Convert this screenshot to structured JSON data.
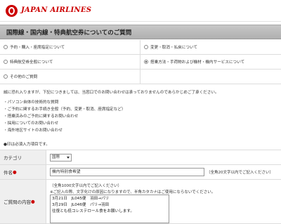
{
  "brand": {
    "name": "JAPAN AIRLINES",
    "color": "#cc0000"
  },
  "page_title": "国際線・国内線・特典航空券についてのご質問",
  "topics": [
    {
      "label": "予約・購入・座席指定について",
      "checked": false
    },
    {
      "label": "変更・取消・払戻について",
      "checked": false
    },
    {
      "label": "特典航空券全般について",
      "checked": false
    },
    {
      "label": "搭乗方法・手荷物および機材・機内サービスについて",
      "checked": true
    },
    {
      "label": "その他のご質問",
      "checked": false
    }
  ],
  "intro": "誠に恐れ入りますが、下記につきましては、当窓口でのお問い合わせは承っておりませんのであらかじめご了承ください。",
  "bullets": [
    "パソコン自体の技術的な質問",
    "ご予約に関するお手続き全般（予約、変更・取消、座席指定など）",
    "搭乗済みのご予約に関するお問い合わせ",
    "採用についてのお問い合わせ",
    "海外地区サイトのお問い合わせ"
  ],
  "required_note": "●印は必須入力項目です。",
  "form": {
    "category_label": "カテゴリ",
    "category_value": "国際",
    "subject_label": "件名",
    "subject_value": "機内特別食希望",
    "subject_hint": "（全角20文字以内でご記入ください）",
    "body_label": "ご質問の内容",
    "body_hint1": "（全角1000文字以内でご記入ください）",
    "body_hint2": "※ご記入の際、文字化けの原因になりますので、半角カタカナはご使用にならないでください。",
    "body_lines": [
      "3月21日　JL045便　羽田→パリ",
      "3月29日　JL046便　パリ→羽田",
      "往復とも低コレステロール食をお願いします。"
    ]
  },
  "required_marker": "●"
}
